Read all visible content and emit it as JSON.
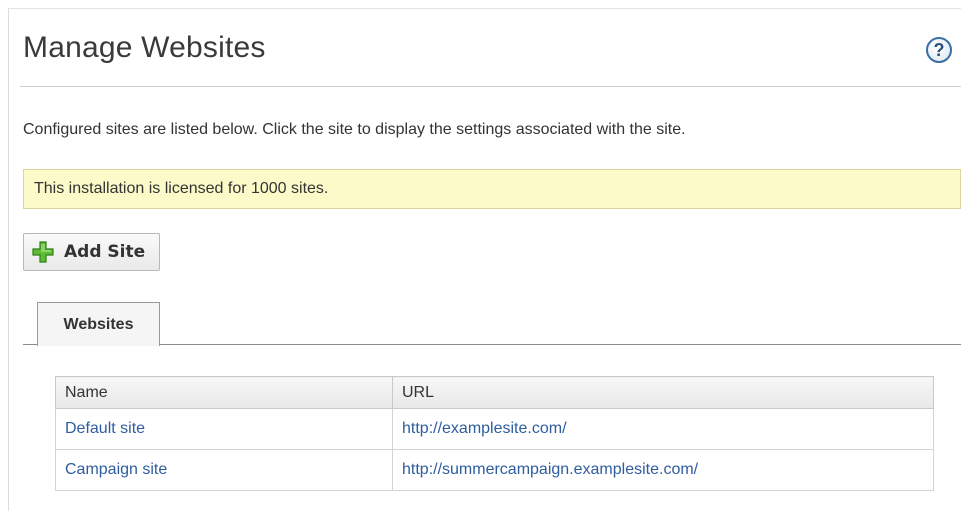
{
  "header": {
    "title": "Manage Websites",
    "help_icon": "help-question-icon",
    "help_symbol": "?"
  },
  "intro": {
    "text": "Configured sites are listed below. Click the site to display the settings associated with the site."
  },
  "license": {
    "text": "This installation is licensed for 1000 sites.",
    "background_color": "#fcfac9"
  },
  "toolbar": {
    "add_site_label": "Add Site",
    "add_site_icon": "plus-icon"
  },
  "tabs": [
    {
      "label": "Websites",
      "active": true
    }
  ],
  "table": {
    "columns": [
      "Name",
      "URL"
    ],
    "rows": [
      {
        "name": "Default site",
        "url": "http://examplesite.com/"
      },
      {
        "name": "Campaign site",
        "url": "http://summercampaign.examplesite.com/"
      }
    ]
  },
  "colors": {
    "link": "#2e5d9f",
    "help_icon_border": "#3a6ea5",
    "plus_icon": "#4caf2a"
  }
}
